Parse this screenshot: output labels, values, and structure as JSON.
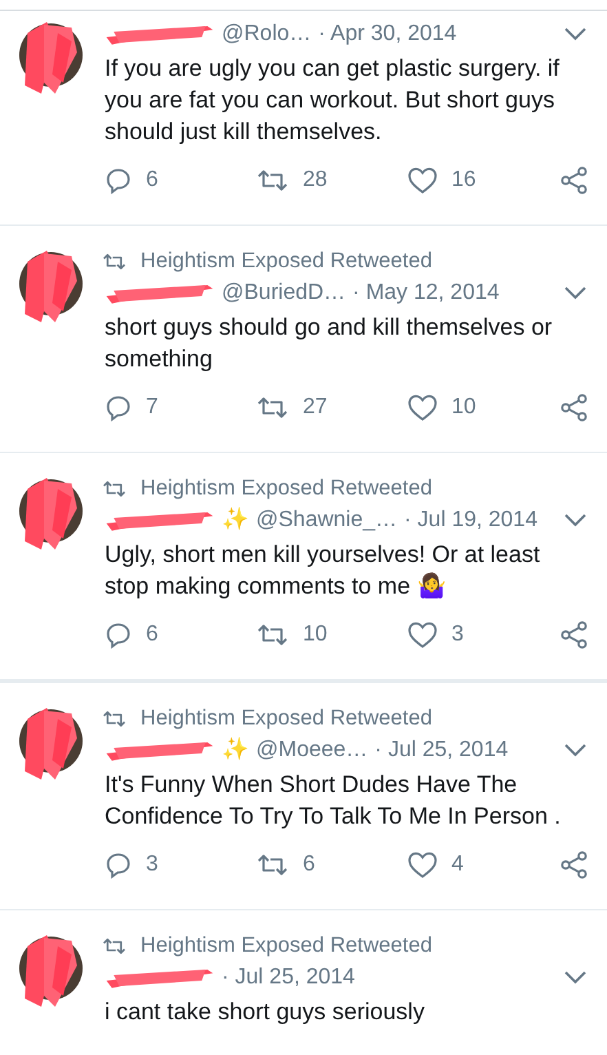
{
  "tweets": [
    {
      "handle": "@Rolo…",
      "date": "· Apr 30, 2014",
      "text": "If you are ugly you can get plastic surgery. if you are fat you can workout. But short guys should just kill themselves.",
      "actions": {
        "replies": "6",
        "retweets": "28",
        "likes": "16"
      }
    },
    {
      "retweeted_by": "Heightism Exposed Retweeted",
      "handle": "@BuriedD…",
      "date": "· May 12, 2014",
      "text": "short guys should go and kill themselves or something",
      "actions": {
        "replies": "7",
        "retweets": "27",
        "likes": "10"
      }
    },
    {
      "retweeted_by": "Heightism Exposed Retweeted",
      "badge": "✨",
      "handle": "@Shawnie_…",
      "date": "· Jul 19, 2014",
      "text": "Ugly, short men kill yourselves! Or at least stop making comments to me 🤷‍♀️",
      "actions": {
        "replies": "6",
        "retweets": "10",
        "likes": "3"
      }
    },
    {
      "retweeted_by": "Heightism Exposed Retweeted",
      "badge": "✨",
      "handle": "@Moeee…",
      "date": "· Jul 25, 2014",
      "text": "It's Funny When Short Dudes Have The Confidence To Try To Talk To Me In Person .",
      "actions": {
        "replies": "3",
        "retweets": "6",
        "likes": "4"
      }
    },
    {
      "retweeted_by": "Heightism Exposed Retweeted",
      "date": "· Jul 25, 2014",
      "text": "i cant take short guys seriously"
    }
  ]
}
